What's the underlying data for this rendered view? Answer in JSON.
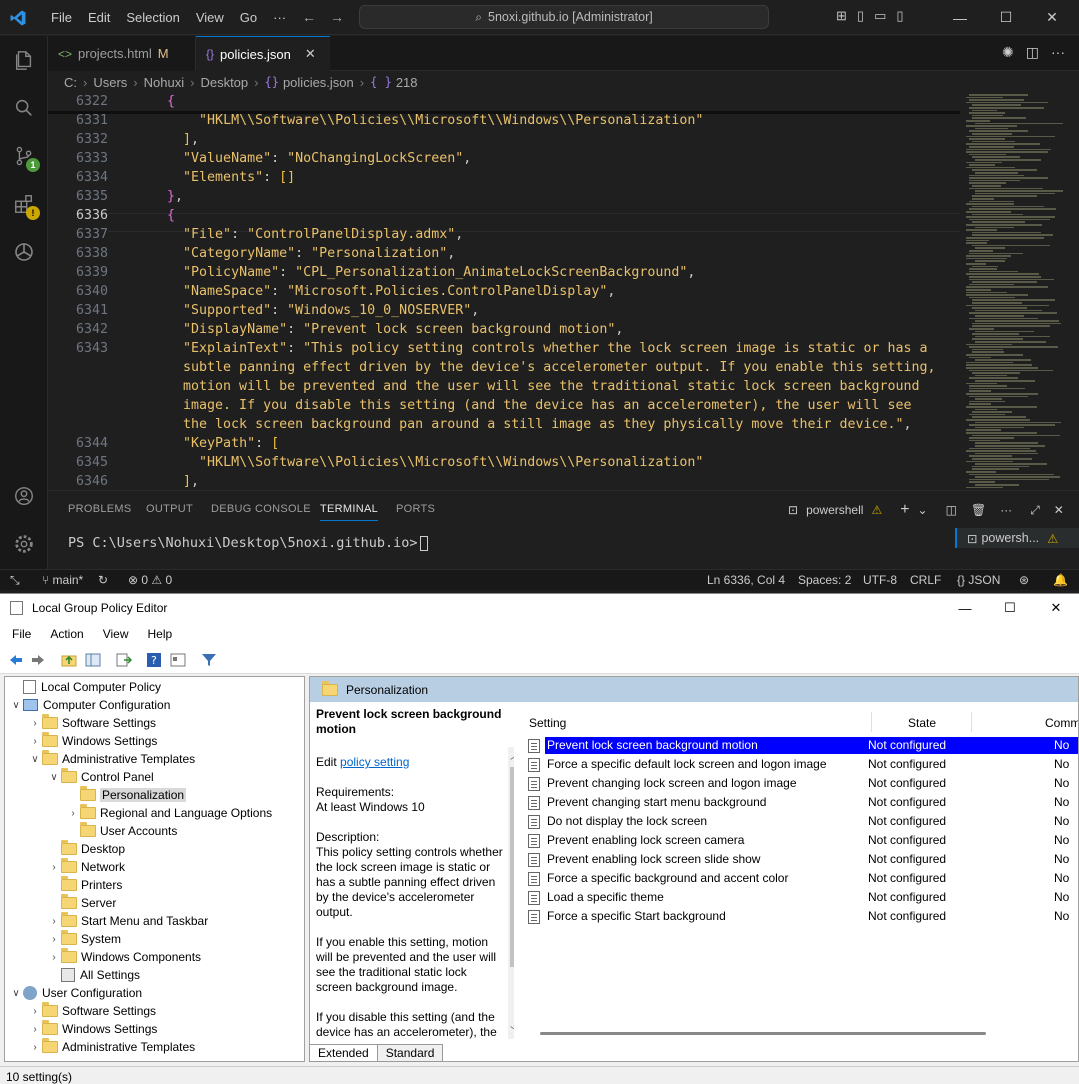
{
  "vscode": {
    "menu": [
      "File",
      "Edit",
      "Selection",
      "View",
      "Go",
      "···"
    ],
    "command_center": "5noxi.github.io [Administrator]",
    "tabs": [
      {
        "label": "projects.html",
        "modified": "M",
        "icon": "<>"
      },
      {
        "label": "policies.json",
        "icon": "{}"
      }
    ],
    "breadcrumb": [
      "C:",
      "Users",
      "Nohuxi",
      "Desktop",
      "policies.json",
      "218"
    ],
    "badges": {
      "source_control": "1"
    },
    "editor_lines": [
      {
        "n": "6322",
        "code": [
          [
            "p",
            "  "
          ],
          [
            "b2",
            "{"
          ]
        ]
      },
      {
        "n": "6331",
        "code": [
          [
            "p",
            "      "
          ],
          [
            "s",
            "\"HKLM\\\\Software\\\\Policies\\\\Microsoft\\\\Windows\\\\Personalization\""
          ]
        ]
      },
      {
        "n": "6332",
        "code": [
          [
            "p",
            "    "
          ],
          [
            "b",
            "]"
          ],
          [
            "p",
            ","
          ]
        ]
      },
      {
        "n": "6333",
        "code": [
          [
            "p",
            "    "
          ],
          [
            "k",
            "\"ValueName\""
          ],
          [
            "p",
            ": "
          ],
          [
            "s",
            "\"NoChangingLockScreen\""
          ],
          [
            "p",
            ","
          ]
        ]
      },
      {
        "n": "6334",
        "code": [
          [
            "p",
            "    "
          ],
          [
            "k",
            "\"Elements\""
          ],
          [
            "p",
            ": "
          ],
          [
            "b",
            "[]"
          ]
        ]
      },
      {
        "n": "6335",
        "code": [
          [
            "p",
            "  "
          ],
          [
            "b2",
            "}"
          ],
          [
            "p",
            ","
          ]
        ]
      },
      {
        "n": "6336",
        "code": [
          [
            "p",
            "  "
          ],
          [
            "b2",
            "{"
          ]
        ],
        "current": true
      },
      {
        "n": "6337",
        "code": [
          [
            "p",
            "    "
          ],
          [
            "k",
            "\"File\""
          ],
          [
            "p",
            ": "
          ],
          [
            "s",
            "\"ControlPanelDisplay.admx\""
          ],
          [
            "p",
            ","
          ]
        ]
      },
      {
        "n": "6338",
        "code": [
          [
            "p",
            "    "
          ],
          [
            "k",
            "\"CategoryName\""
          ],
          [
            "p",
            ": "
          ],
          [
            "s",
            "\"Personalization\""
          ],
          [
            "p",
            ","
          ]
        ]
      },
      {
        "n": "6339",
        "code": [
          [
            "p",
            "    "
          ],
          [
            "k",
            "\"PolicyName\""
          ],
          [
            "p",
            ": "
          ],
          [
            "s",
            "\"CPL_Personalization_AnimateLockScreenBackground\""
          ],
          [
            "p",
            ","
          ]
        ]
      },
      {
        "n": "6340",
        "code": [
          [
            "p",
            "    "
          ],
          [
            "k",
            "\"NameSpace\""
          ],
          [
            "p",
            ": "
          ],
          [
            "s",
            "\"Microsoft.Policies.ControlPanelDisplay\""
          ],
          [
            "p",
            ","
          ]
        ]
      },
      {
        "n": "6341",
        "code": [
          [
            "p",
            "    "
          ],
          [
            "k",
            "\"Supported\""
          ],
          [
            "p",
            ": "
          ],
          [
            "s",
            "\"Windows_10_0_NOSERVER\""
          ],
          [
            "p",
            ","
          ]
        ]
      },
      {
        "n": "6342",
        "code": [
          [
            "p",
            "    "
          ],
          [
            "k",
            "\"DisplayName\""
          ],
          [
            "p",
            ": "
          ],
          [
            "s",
            "\"Prevent lock screen background motion\""
          ],
          [
            "p",
            ","
          ]
        ]
      },
      {
        "n": "6343",
        "code": [
          [
            "p",
            "    "
          ],
          [
            "k",
            "\"ExplainText\""
          ],
          [
            "p",
            ": "
          ],
          [
            "s",
            "\"This policy setting controls whether the lock screen image is static or has a"
          ]
        ]
      },
      {
        "n": "",
        "code": [
          [
            "s",
            "    subtle panning effect driven by the device's accelerometer output. If you enable this setting,"
          ]
        ]
      },
      {
        "n": "",
        "code": [
          [
            "s",
            "    motion will be prevented and the user will see the traditional static lock screen background"
          ]
        ]
      },
      {
        "n": "",
        "code": [
          [
            "s",
            "    image. If you disable this setting (and the device has an accelerometer), the user will see"
          ]
        ]
      },
      {
        "n": "",
        "code": [
          [
            "s",
            "    the lock screen background pan around a still image as they physically move their device.\""
          ],
          [
            "p",
            ","
          ]
        ]
      },
      {
        "n": "6344",
        "code": [
          [
            "p",
            "    "
          ],
          [
            "k",
            "\"KeyPath\""
          ],
          [
            "p",
            ": "
          ],
          [
            "b",
            "["
          ]
        ]
      },
      {
        "n": "6345",
        "code": [
          [
            "p",
            "      "
          ],
          [
            "s",
            "\"HKLM\\\\Software\\\\Policies\\\\Microsoft\\\\Windows\\\\Personalization\""
          ]
        ]
      },
      {
        "n": "6346",
        "code": [
          [
            "p",
            "    "
          ],
          [
            "b",
            "]"
          ],
          [
            "p",
            ","
          ]
        ]
      }
    ],
    "panel_tabs": [
      "PROBLEMS",
      "OUTPUT",
      "DEBUG CONSOLE",
      "TERMINAL",
      "PORTS"
    ],
    "terminal_shell": "powershell",
    "terminal_prompt": "PS C:\\Users\\Nohuxi\\Desktop\\5noxi.github.io>",
    "terminal_list_item": "powersh...",
    "status": {
      "branch": "main*",
      "errors": "0",
      "warnings": "0",
      "position": "Ln 6336, Col 4",
      "spaces": "Spaces: 2",
      "encoding": "UTF-8",
      "eol": "CRLF",
      "language": "JSON"
    }
  },
  "gpe": {
    "title": "Local Group Policy Editor",
    "menu": [
      "File",
      "Action",
      "View",
      "Help"
    ],
    "tree": [
      {
        "label": "Local Computer Policy",
        "depth": 0,
        "chev": "",
        "icon": "policy"
      },
      {
        "label": "Computer Configuration",
        "depth": 0,
        "chev": "∨",
        "icon": "computer"
      },
      {
        "label": "Software Settings",
        "depth": 1,
        "chev": "›"
      },
      {
        "label": "Windows Settings",
        "depth": 1,
        "chev": "›"
      },
      {
        "label": "Administrative Templates",
        "depth": 1,
        "chev": "∨"
      },
      {
        "label": "Control Panel",
        "depth": 2,
        "chev": "∨"
      },
      {
        "label": "Personalization",
        "depth": 3,
        "chev": "",
        "selected": true
      },
      {
        "label": "Regional and Language Options",
        "depth": 3,
        "chev": "›"
      },
      {
        "label": "User Accounts",
        "depth": 3,
        "chev": ""
      },
      {
        "label": "Desktop",
        "depth": 2,
        "chev": ""
      },
      {
        "label": "Network",
        "depth": 2,
        "chev": "›"
      },
      {
        "label": "Printers",
        "depth": 2,
        "chev": ""
      },
      {
        "label": "Server",
        "depth": 2,
        "chev": ""
      },
      {
        "label": "Start Menu and Taskbar",
        "depth": 2,
        "chev": "›"
      },
      {
        "label": "System",
        "depth": 2,
        "chev": "›"
      },
      {
        "label": "Windows Components",
        "depth": 2,
        "chev": "›"
      },
      {
        "label": "All Settings",
        "depth": 2,
        "chev": "",
        "icon": "allsettings"
      },
      {
        "label": "User Configuration",
        "depth": 0,
        "chev": "∨",
        "icon": "user"
      },
      {
        "label": "Software Settings",
        "depth": 1,
        "chev": "›"
      },
      {
        "label": "Windows Settings",
        "depth": 1,
        "chev": "›"
      },
      {
        "label": "Administrative Templates",
        "depth": 1,
        "chev": "›"
      }
    ],
    "header": "Personalization",
    "description": {
      "title": "Prevent lock screen background motion",
      "edit_prefix": "Edit",
      "edit_link": "policy setting",
      "requirements_label": "Requirements:",
      "requirements": "At least Windows 10",
      "description_label": "Description:",
      "para1": "This policy setting controls whether the lock screen image is static or has a subtle panning effect driven by the device's accelerometer output.",
      "para2": "If you enable this setting, motion will be prevented and the user will see the traditional static lock screen background image.",
      "para3": "If you disable this setting (and the device has an accelerometer), the"
    },
    "columns": [
      "Setting",
      "State",
      "Comm"
    ],
    "settings": [
      {
        "name": "Prevent lock screen background motion",
        "state": "Not configured",
        "comment": "No",
        "selected": true
      },
      {
        "name": "Force a specific default lock screen and logon image",
        "state": "Not configured",
        "comment": "No"
      },
      {
        "name": "Prevent changing lock screen and logon image",
        "state": "Not configured",
        "comment": "No"
      },
      {
        "name": "Prevent changing start menu background",
        "state": "Not configured",
        "comment": "No"
      },
      {
        "name": "Do not display the lock screen",
        "state": "Not configured",
        "comment": "No"
      },
      {
        "name": "Prevent enabling lock screen camera",
        "state": "Not configured",
        "comment": "No"
      },
      {
        "name": "Prevent enabling lock screen slide show",
        "state": "Not configured",
        "comment": "No"
      },
      {
        "name": "Force a specific background and accent color",
        "state": "Not configured",
        "comment": "No"
      },
      {
        "name": "Load a specific theme",
        "state": "Not configured",
        "comment": "No"
      },
      {
        "name": "Force a specific Start background",
        "state": "Not configured",
        "comment": "No"
      }
    ],
    "bottom_tabs": [
      "Extended",
      "Standard"
    ],
    "status": "10 setting(s)"
  }
}
